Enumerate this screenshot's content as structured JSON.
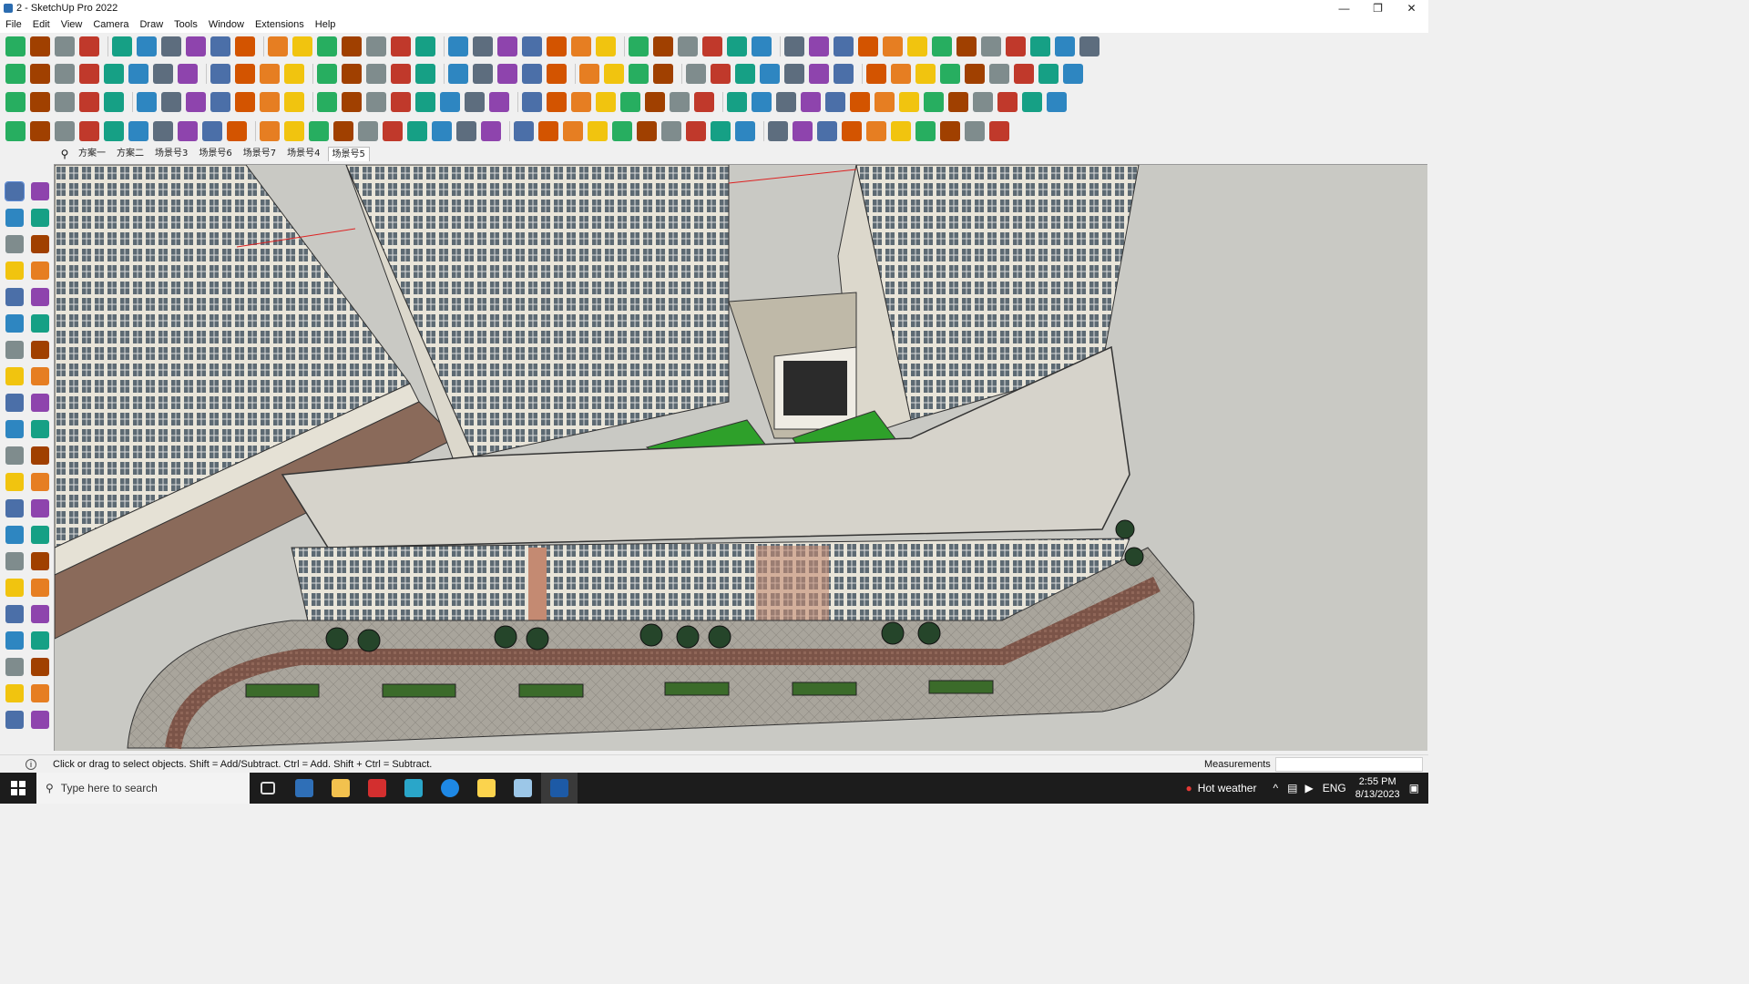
{
  "window": {
    "title": "2 - SketchUp Pro 2022"
  },
  "menu": [
    "File",
    "Edit",
    "View",
    "Camera",
    "Draw",
    "Tools",
    "Window",
    "Extensions",
    "Help"
  ],
  "scene_tabs": [
    "方案一",
    "方案二",
    "场景号3",
    "场景号6",
    "场景号7",
    "场景号4",
    "场景号5"
  ],
  "active_tab": "场景号5",
  "status": {
    "message": "Click or drag to select objects. Shift = Add/Subtract. Ctrl = Add. Shift + Ctrl = Subtract.",
    "measurements_label": "Measurements",
    "measurements_value": ""
  },
  "taskbar": {
    "search_placeholder": "Type here to search",
    "weather": "Hot weather",
    "language": "ENG",
    "time": "2:55 PM",
    "date": "8/13/2023"
  },
  "colors": {
    "viewport_bg": "#c8c8c3",
    "grass": "#2ea02a",
    "paving": "#8a6a5a",
    "building": "#e6e2d6"
  }
}
